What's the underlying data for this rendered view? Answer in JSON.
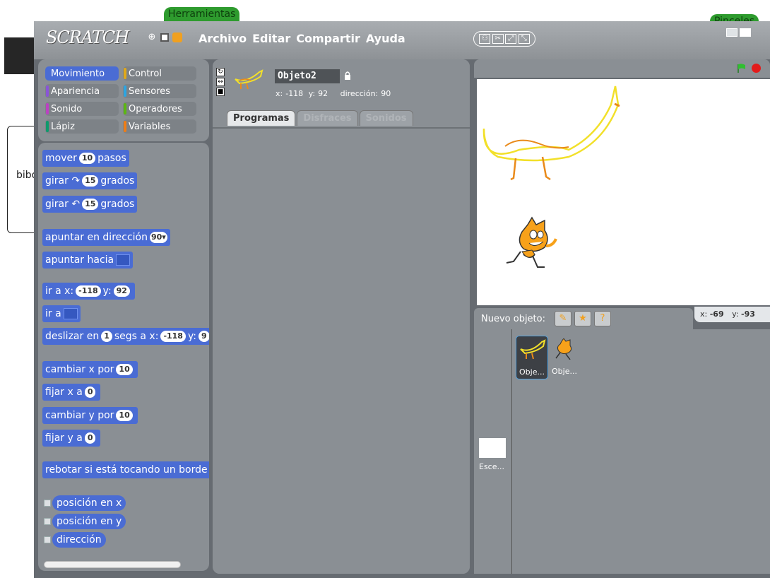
{
  "background": {
    "herramientas_label": "Herramientas",
    "pinceles_label": "Pinceles",
    "box_text": "bibo"
  },
  "menubar": {
    "logo": "SCRATCH",
    "menu": [
      "Archivo",
      "Editar",
      "Compartir",
      "Ayuda"
    ]
  },
  "categories": [
    {
      "label": "Movimiento",
      "color": "#4a6cd4",
      "selected": true
    },
    {
      "label": "Control",
      "color": "#e1a91a",
      "selected": false
    },
    {
      "label": "Apariencia",
      "color": "#8a55d7",
      "selected": false
    },
    {
      "label": "Sensores",
      "color": "#2ca5e2",
      "selected": false
    },
    {
      "label": "Sonido",
      "color": "#bb42c3",
      "selected": false
    },
    {
      "label": "Operadores",
      "color": "#5cb712",
      "selected": false
    },
    {
      "label": "Lápiz",
      "color": "#0e9a6c",
      "selected": false
    },
    {
      "label": "Variables",
      "color": "#ee7d16",
      "selected": false
    }
  ],
  "blocks": {
    "mover": {
      "pre": "mover",
      "num": "10",
      "post": "pasos"
    },
    "girar_der": {
      "pre": "girar ↷",
      "num": "15",
      "post": "grados"
    },
    "girar_izq": {
      "pre": "girar ↶",
      "num": "15",
      "post": "grados"
    },
    "apuntar_dir": {
      "pre": "apuntar en dirección",
      "num": "90▾"
    },
    "apuntar_hacia": {
      "pre": "apuntar hacia"
    },
    "ir_a_xy": {
      "pre": "ir a x:",
      "x": "-118",
      "mid": "y:",
      "y": "92"
    },
    "ir_a": {
      "pre": "ir a"
    },
    "deslizar": {
      "pre": "deslizar en",
      "n": "1",
      "mid": "segs a x:",
      "x": "-118",
      "mid2": "y:",
      "y": "9"
    },
    "cambiar_x": {
      "pre": "cambiar x por",
      "num": "10"
    },
    "fijar_x": {
      "pre": "fijar x a",
      "num": "0"
    },
    "cambiar_y": {
      "pre": "cambiar y por",
      "num": "10"
    },
    "fijar_y": {
      "pre": "fijar y a",
      "num": "0"
    },
    "rebotar": {
      "pre": "rebotar si está tocando un borde"
    },
    "posicion_x": "posición en x",
    "posicion_y": "posición en y",
    "direccion": "dirección"
  },
  "sprite": {
    "name": "Objeto2",
    "x_label": "x:",
    "x": "-118",
    "y_label": "y:",
    "y": "92",
    "dir_label": "dirección:",
    "dir": "90"
  },
  "tabs": [
    {
      "label": "Programas",
      "active": true
    },
    {
      "label": "Disfraces",
      "active": false
    },
    {
      "label": "Sonidos",
      "active": false
    }
  ],
  "stage": {
    "pointer_x_label": "x:",
    "pointer_x": "-69",
    "pointer_y_label": "y:",
    "pointer_y": "-93"
  },
  "sprite_list": {
    "new_sprite_label": "Nuevo objeto:",
    "stage_label": "Esce...",
    "tiles": [
      "Obje...",
      "Obje..."
    ]
  }
}
